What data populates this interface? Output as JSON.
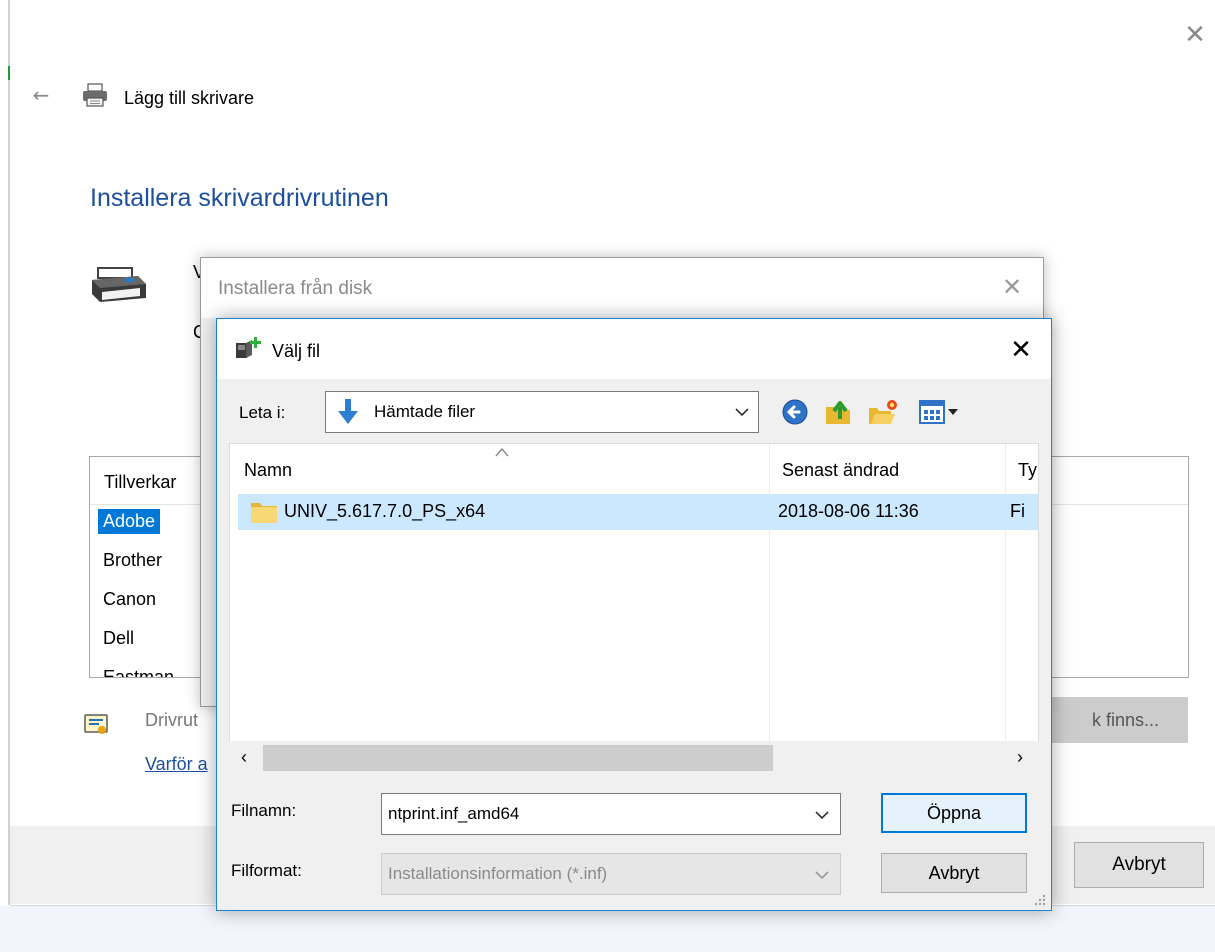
{
  "wizard": {
    "title": "Lägg till skrivare",
    "heading": "Installera skrivardrivrutinen",
    "stub_line_1": "V",
    "stub_line_2": "C",
    "manufacturer_header": "Tillverkar",
    "manufacturers": [
      "Adobe",
      "Brother",
      "Canon",
      "Dell",
      "Eastman"
    ],
    "selected_manufacturer": "Adobe",
    "driver_signed_text": "Drivrut",
    "why_link": "Varför a",
    "have_disk_button": "k finns...",
    "cancel_button": "Avbryt"
  },
  "disk_dialog": {
    "title": "Installera från disk"
  },
  "file_dialog": {
    "title": "Välj fil",
    "look_in_label": "Leta i:",
    "look_in_value": "Hämtade filer",
    "columns": {
      "name": "Namn",
      "date": "Senast ändrad",
      "type": "Ty"
    },
    "files": [
      {
        "name": "UNIV_5.617.7.0_PS_x64",
        "date": "2018-08-06 11:36",
        "type": "Fi",
        "selected": true
      }
    ],
    "filename_label": "Filnamn:",
    "filename_value": "ntprint.inf_amd64",
    "filetype_label": "Filformat:",
    "filetype_value": "Installationsinformation (*.inf)",
    "open_button": "Öppna",
    "cancel_button": "Avbryt"
  },
  "colors": {
    "accent": "#0078d7",
    "heading_blue": "#1c4f9c",
    "selection": "#cce8ff"
  }
}
